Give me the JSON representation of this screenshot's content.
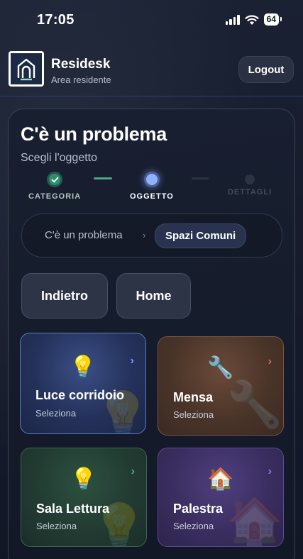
{
  "status_bar": {
    "time": "17:05",
    "battery": "64"
  },
  "header": {
    "app_name": "Residesk",
    "app_subtitle": "Area residente",
    "logout_label": "Logout"
  },
  "page": {
    "title": "C'è un problema",
    "subtitle": "Scegli l'oggetto"
  },
  "stepper": {
    "steps": [
      {
        "label": "CATEGORIA",
        "state": "done"
      },
      {
        "label": "OGGETTO",
        "state": "active"
      },
      {
        "label": "DETTAGLI",
        "state": "todo"
      }
    ]
  },
  "breadcrumb": {
    "root": "C'è un problema",
    "separator": "›",
    "current": "Spazi Comuni"
  },
  "nav": {
    "back_label": "Indietro",
    "home_label": "Home"
  },
  "tiles": [
    {
      "title": "Luce corridoio",
      "subtitle": "Seleziona",
      "icon": "lightbulb-icon",
      "glyph": "💡",
      "chevron": "›",
      "accent": "#5a78d0"
    },
    {
      "title": "Mensa",
      "subtitle": "Seleziona",
      "icon": "wrench-icon",
      "glyph": "🔧",
      "chevron": "›",
      "accent": "#7a5540"
    },
    {
      "title": "Sala Lettura",
      "subtitle": "Seleziona",
      "icon": "lightbulb-icon",
      "glyph": "💡",
      "chevron": "›",
      "accent": "#3c6650"
    },
    {
      "title": "Palestra",
      "subtitle": "Seleziona",
      "icon": "house-icon",
      "glyph": "🏠",
      "chevron": "›",
      "accent": "#5c4a96"
    }
  ],
  "colors": {
    "primary": "#5a78d0",
    "success": "#2f8f6e",
    "background": "#141a2b"
  }
}
